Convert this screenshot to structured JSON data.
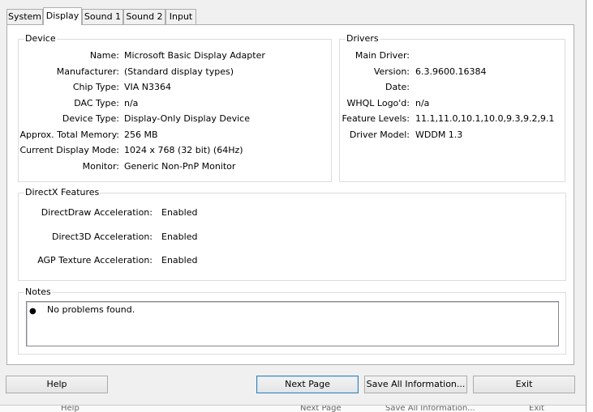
{
  "tabs": [
    {
      "label": "System"
    },
    {
      "label": "Display"
    },
    {
      "label": "Sound 1"
    },
    {
      "label": "Sound 2"
    },
    {
      "label": "Input"
    }
  ],
  "device": {
    "title": "Device",
    "rows": [
      {
        "label": "Name:",
        "value": "Microsoft Basic Display Adapter"
      },
      {
        "label": "Manufacturer:",
        "value": "(Standard display types)"
      },
      {
        "label": "Chip Type:",
        "value": "VIA N3364"
      },
      {
        "label": "DAC Type:",
        "value": "n/a"
      },
      {
        "label": "Device Type:",
        "value": "Display-Only Display Device"
      },
      {
        "label": "Approx. Total Memory:",
        "value": "256 MB"
      },
      {
        "label": "Current Display Mode:",
        "value": "1024 x 768 (32 bit) (64Hz)"
      },
      {
        "label": "Monitor:",
        "value": "Generic Non-PnP Monitor"
      }
    ]
  },
  "drivers": {
    "title": "Drivers",
    "rows": [
      {
        "label": "Main Driver:",
        "value": ""
      },
      {
        "label": "Version:",
        "value": "6.3.9600.16384"
      },
      {
        "label": "Date:",
        "value": ""
      },
      {
        "label": "WHQL Logo'd:",
        "value": "n/a"
      },
      {
        "label": "Feature Levels:",
        "value": "11.1,11.0,10.1,10.0,9.3,9.2,9.1"
      },
      {
        "label": "Driver Model:",
        "value": "WDDM 1.3"
      }
    ]
  },
  "directx": {
    "title": "DirectX Features",
    "rows": [
      {
        "label": "DirectDraw Acceleration:",
        "value": "Enabled"
      },
      {
        "label": "Direct3D Acceleration:",
        "value": "Enabled"
      },
      {
        "label": "AGP Texture Acceleration:",
        "value": "Enabled"
      }
    ]
  },
  "notes": {
    "title": "Notes",
    "items": [
      "No problems found."
    ]
  },
  "buttons": {
    "help": "Help",
    "next_page": "Next Page",
    "save_all": "Save All Information...",
    "exit": "Exit"
  },
  "background_window": {
    "fragments": [
      "Help",
      "Next Page",
      "Save All Information...",
      "Exit"
    ]
  }
}
